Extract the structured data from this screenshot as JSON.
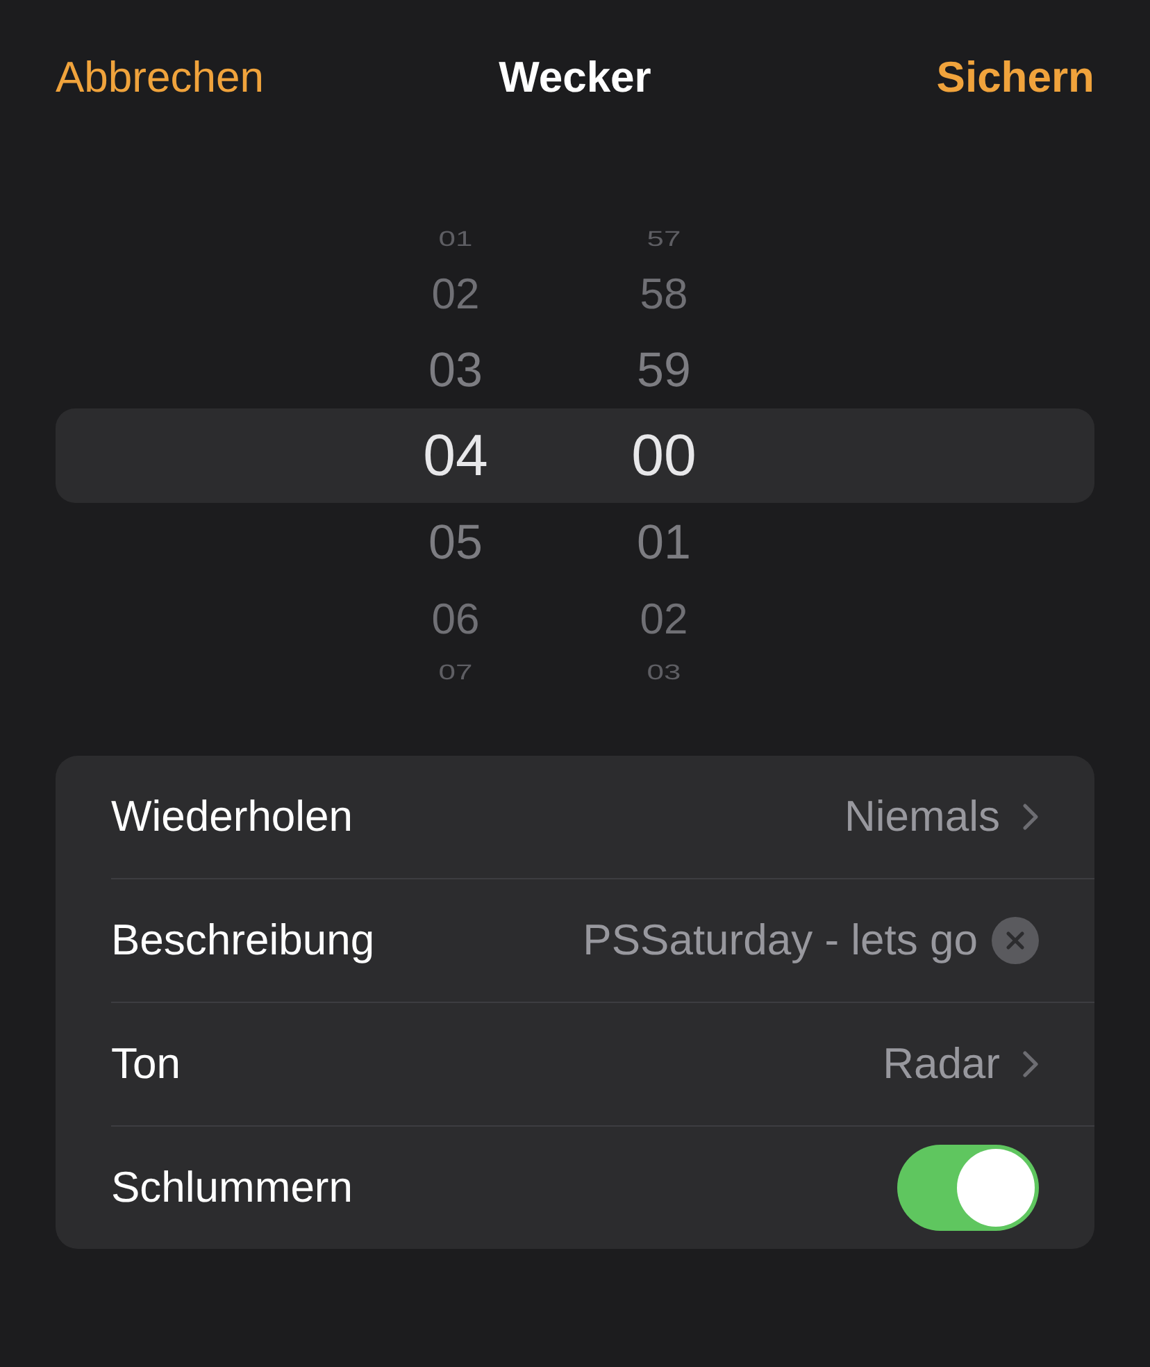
{
  "header": {
    "cancel": "Abbrechen",
    "title": "Wecker",
    "save": "Sichern"
  },
  "picker": {
    "columns": [
      {
        "items": [
          {
            "label": "01",
            "selected": false
          },
          {
            "label": "02",
            "selected": false
          },
          {
            "label": "03",
            "selected": false
          },
          {
            "label": "04",
            "selected": true
          },
          {
            "label": "05",
            "selected": false
          },
          {
            "label": "06",
            "selected": false
          },
          {
            "label": "07",
            "selected": false
          }
        ]
      },
      {
        "items": [
          {
            "label": "57",
            "selected": false
          },
          {
            "label": "58",
            "selected": false
          },
          {
            "label": "59",
            "selected": false
          },
          {
            "label": "00",
            "selected": true
          },
          {
            "label": "01",
            "selected": false
          },
          {
            "label": "02",
            "selected": false
          },
          {
            "label": "03",
            "selected": false
          }
        ]
      }
    ]
  },
  "settings": [
    {
      "kind": "disclosure",
      "label": "Wiederholen",
      "value": "Niemals"
    },
    {
      "kind": "text_field",
      "label": "Beschreibung",
      "value": "PSSaturday - lets go"
    },
    {
      "kind": "disclosure",
      "label": "Ton",
      "value": "Radar"
    },
    {
      "kind": "toggle",
      "label": "Schlummern",
      "on": true
    }
  ]
}
